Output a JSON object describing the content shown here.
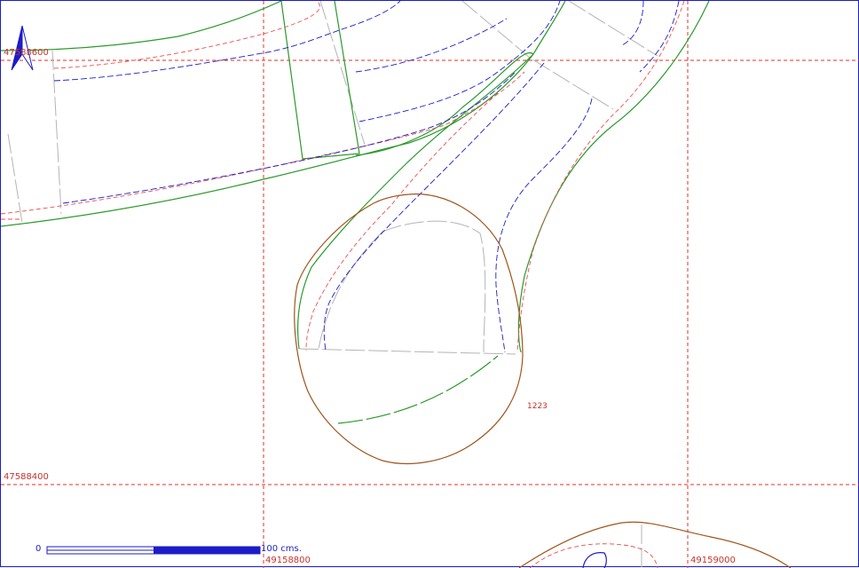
{
  "map": {
    "coordinates": {
      "northing_top": "47588600",
      "northing_bottom": "47588400",
      "easting_left": "49158800",
      "easting_right": "49159000"
    },
    "parcel_label": "1223",
    "scale_bar": {
      "start_label": "0",
      "end_label": "100 cms."
    },
    "north_arrow_icon": "north-arrow-icon",
    "colors": {
      "grid": "#e0302a",
      "parcel_boundary": "#a0551c",
      "road_edge": "#2a9a2a",
      "curb_red": "#e85050",
      "centerline_blue": "#1c1cc8",
      "lot_lines": "#b0b0b0",
      "frame": "#1c1cc8"
    }
  }
}
